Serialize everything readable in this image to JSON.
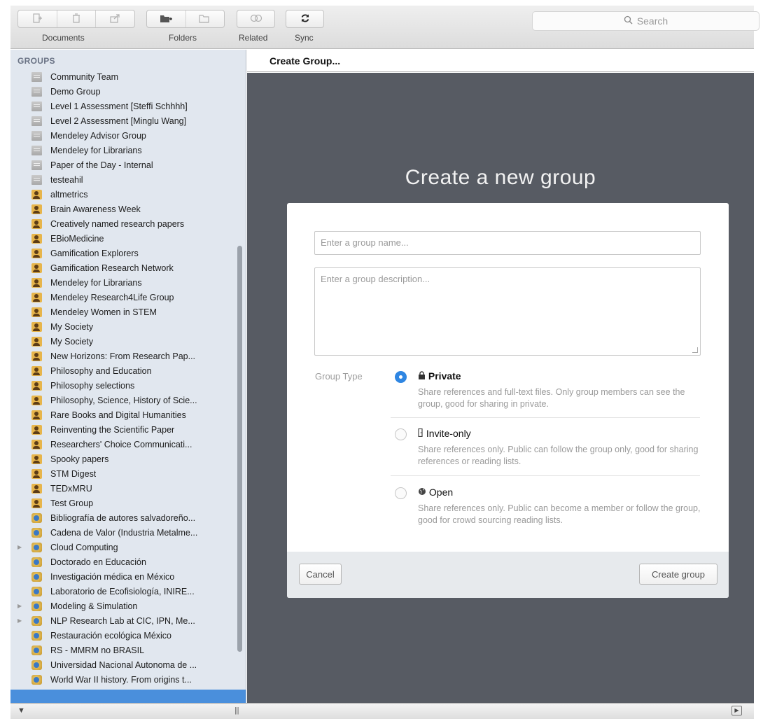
{
  "toolbar": {
    "documents_label": "Documents",
    "folders_label": "Folders",
    "related_label": "Related",
    "sync_label": "Sync",
    "search_placeholder": "Search"
  },
  "sidebar": {
    "header": "GROUPS",
    "groups": [
      {
        "label": "Community Team",
        "icon": "gray-group-icon"
      },
      {
        "label": "Demo Group",
        "icon": "gray-group-icon"
      },
      {
        "label": "Level 1 Assessment [Steffi Schhhh]",
        "icon": "gray-group-icon"
      },
      {
        "label": "Level 2 Assessment [Minglu Wang]",
        "icon": "gray-group-icon"
      },
      {
        "label": "Mendeley Advisor Group",
        "icon": "gray-group-icon"
      },
      {
        "label": "Mendeley for Librarians",
        "icon": "gray-group-icon"
      },
      {
        "label": "Paper of the Day - Internal",
        "icon": "gray-group-icon"
      },
      {
        "label": "testeahil",
        "icon": "gray-group-icon"
      },
      {
        "label": "altmetrics",
        "icon": "user-group-icon"
      },
      {
        "label": "Brain Awareness Week",
        "icon": "user-group-icon"
      },
      {
        "label": "Creatively named research papers",
        "icon": "user-group-icon"
      },
      {
        "label": "EBioMedicine",
        "icon": "user-group-icon"
      },
      {
        "label": "Gamification Explorers",
        "icon": "user-group-icon"
      },
      {
        "label": "Gamification Research Network",
        "icon": "user-group-icon"
      },
      {
        "label": "Mendeley for Librarians",
        "icon": "user-group-icon"
      },
      {
        "label": "Mendeley Research4Life Group",
        "icon": "user-group-icon"
      },
      {
        "label": "Mendeley Women in STEM",
        "icon": "user-group-icon"
      },
      {
        "label": "My Society",
        "icon": "user-group-icon"
      },
      {
        "label": "My Society",
        "icon": "user-group-icon"
      },
      {
        "label": "New Horizons: From Research Pap...",
        "icon": "user-group-icon"
      },
      {
        "label": "Philosophy and Education",
        "icon": "user-group-icon"
      },
      {
        "label": "Philosophy selections",
        "icon": "user-group-icon"
      },
      {
        "label": "Philosophy, Science, History of Scie...",
        "icon": "user-group-icon"
      },
      {
        "label": "Rare Books and Digital Humanities",
        "icon": "user-group-icon"
      },
      {
        "label": "Reinventing the Scientific Paper",
        "icon": "user-group-icon"
      },
      {
        "label": "Researchers' Choice Communicati...",
        "icon": "user-group-icon"
      },
      {
        "label": "Spooky papers",
        "icon": "user-group-icon"
      },
      {
        "label": "STM Digest",
        "icon": "user-group-icon"
      },
      {
        "label": "TEDxMRU",
        "icon": "user-group-icon"
      },
      {
        "label": "Test Group",
        "icon": "user-group-icon"
      },
      {
        "label": "Bibliografía de autores salvadoreño...",
        "icon": "globe-group-icon"
      },
      {
        "label": "Cadena de Valor (Industria Metalme...",
        "icon": "globe-group-icon"
      },
      {
        "label": "Cloud Computing",
        "icon": "globe-group-icon",
        "expandable": true
      },
      {
        "label": "Doctorado en Educación",
        "icon": "globe-group-icon"
      },
      {
        "label": "Investigación médica en México",
        "icon": "globe-group-icon"
      },
      {
        "label": "Laboratorio de Ecofisiología, INIRE...",
        "icon": "globe-group-icon"
      },
      {
        "label": "Modeling & Simulation",
        "icon": "globe-group-icon",
        "expandable": true
      },
      {
        "label": "NLP Research Lab at CIC, IPN, Me...",
        "icon": "globe-group-icon",
        "expandable": true
      },
      {
        "label": "Restauración ecológica México",
        "icon": "globe-group-icon"
      },
      {
        "label": "RS - MMRM no BRASIL",
        "icon": "globe-group-icon"
      },
      {
        "label": "Universidad Nacional Autonoma de ...",
        "icon": "globe-group-icon"
      },
      {
        "label": "World War II history. From origins t...",
        "icon": "globe-group-icon"
      }
    ]
  },
  "main": {
    "title": "Create Group...",
    "heading": "Create a new group",
    "form": {
      "name_placeholder": "Enter a group name...",
      "description_placeholder": "Enter a group description...",
      "group_type_label": "Group Type",
      "options": [
        {
          "title": "Private",
          "icon": "lock-icon",
          "selected": true,
          "description": "Share references and full-text files. Only group members can see the group, good for sharing in private."
        },
        {
          "title": "Invite-only",
          "icon": "door-icon",
          "selected": false,
          "description": "Share references only. Public can follow the group only, good for sharing references or reading lists."
        },
        {
          "title": "Open",
          "icon": "globe-icon",
          "selected": false,
          "description": "Share references only. Public can become a member or follow the group, good for crowd sourcing reading lists."
        }
      ],
      "cancel_label": "Cancel",
      "create_label": "Create group"
    }
  },
  "colors": {
    "sidebar_bg": "#e1e7ef",
    "content_bg": "#575b63",
    "selection_accent": "#4a8fdc",
    "radio_selected": "#2f86e2"
  }
}
